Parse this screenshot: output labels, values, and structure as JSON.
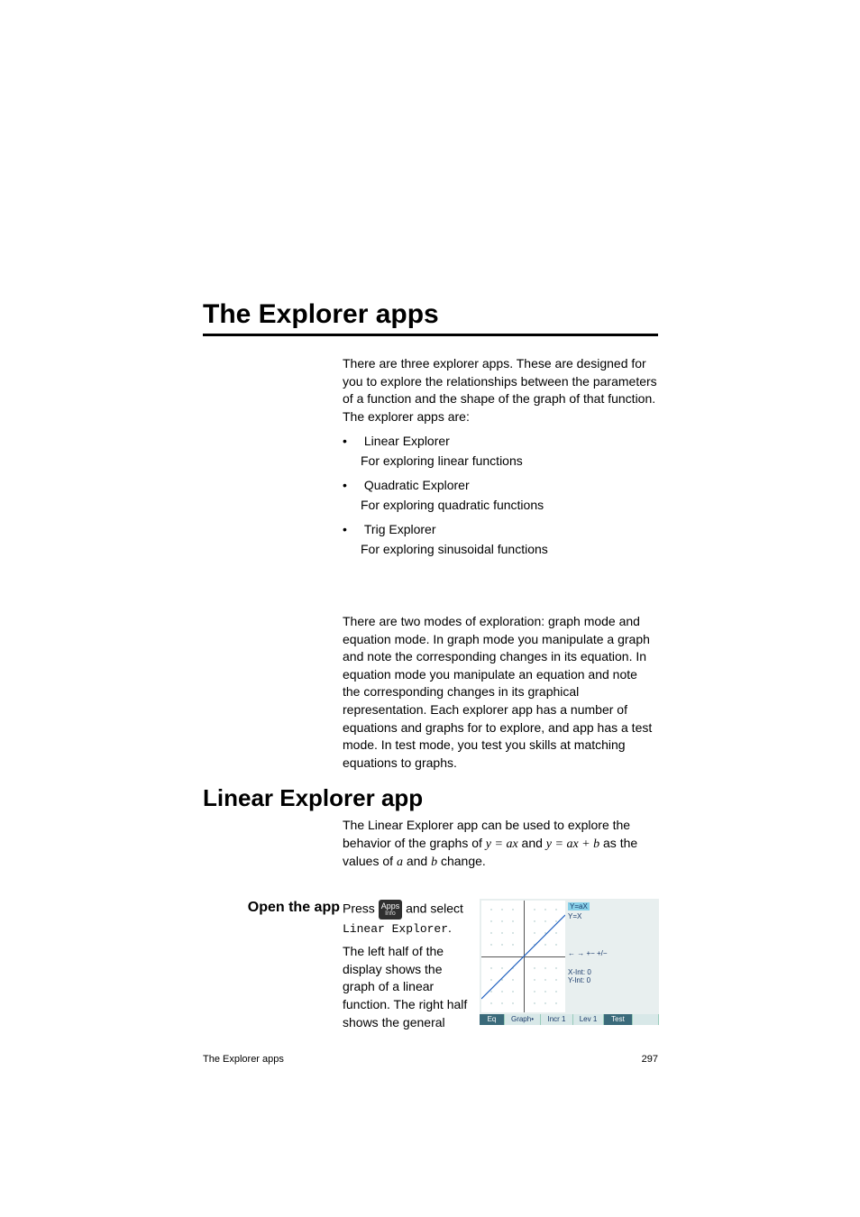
{
  "h1": "The Explorer apps",
  "intro": "There are three explorer apps. These are designed for you to explore the relationships between the parameters of a function and the shape of the graph of that function. The explorer apps are:",
  "items": [
    {
      "name": "Linear Explorer",
      "desc": "For exploring linear functions"
    },
    {
      "name": "Quadratic Explorer",
      "desc": "For exploring quadratic functions"
    },
    {
      "name": "Trig Explorer",
      "desc": "For exploring sinusoidal functions"
    }
  ],
  "modes": "There are two modes of exploration: graph mode and equation mode. In graph mode you manipulate a graph and note the corresponding changes in its equation. In equation mode you manipulate an equation and note the corresponding changes in its graphical representation. Each explorer app has a number of equations and graphs for to explore, and app has a test mode. In test mode, you test you skills at matching equations to graphs.",
  "h2": "Linear Explorer app",
  "desc2_a": "The Linear Explorer app can be used to explore the behavior of the graphs of ",
  "eq1": "y = ax",
  "desc2_b": " and ",
  "eq2": "y = ax + b",
  "desc2_c": " as the values of ",
  "ita": "a",
  "desc2_d": " and ",
  "itb": "b",
  "desc2_e": " change.",
  "h3": "Open the app",
  "step_a": "Press ",
  "key_top": "Apps",
  "key_sub": "Info",
  "step_b": " and select ",
  "step_mono": "Linear Explorer",
  "step_c": ".",
  "step_p2": "The left half of the display shows the graph of a linear function. The right half shows the general",
  "calc": {
    "eqbox": "Y=aX",
    "yx": "Y=X",
    "arrows": "←  →     +− +/−",
    "xint": "X-Int: 0",
    "yint": "Y-Int: 0",
    "menu": [
      "Eq",
      "Graph•",
      "Incr 1",
      "Lev 1",
      "Test",
      ""
    ]
  },
  "footer_l": "The Explorer apps",
  "footer_r": "297"
}
